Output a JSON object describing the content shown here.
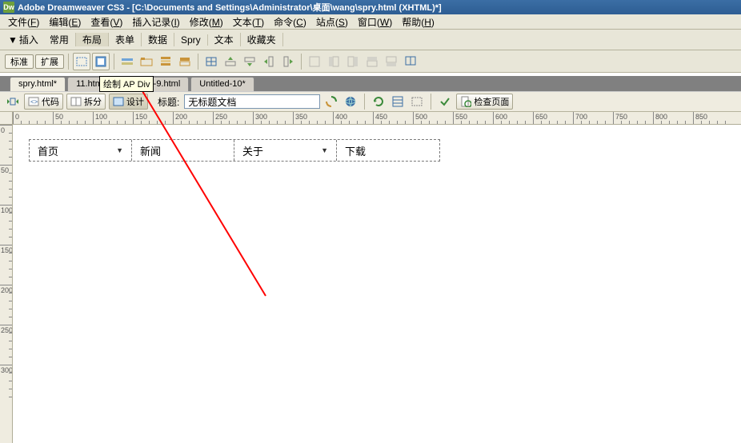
{
  "title": "Adobe Dreamweaver CS3 - [C:\\Documents and Settings\\Administrator\\桌面\\wang\\spry.html (XHTML)*]",
  "dw_badge": "Dw",
  "menu": [
    {
      "l": "文件",
      "k": "F"
    },
    {
      "l": "编辑",
      "k": "E"
    },
    {
      "l": "查看",
      "k": "V"
    },
    {
      "l": "插入记录",
      "k": "I"
    },
    {
      "l": "修改",
      "k": "M"
    },
    {
      "l": "文本",
      "k": "T"
    },
    {
      "l": "命令",
      "k": "C"
    },
    {
      "l": "站点",
      "k": "S"
    },
    {
      "l": "窗口",
      "k": "W"
    },
    {
      "l": "帮助",
      "k": "H"
    }
  ],
  "insert_label": "插入",
  "insert_tabs": [
    "常用",
    "布局",
    "表单",
    "数据",
    "Spry",
    "文本",
    "收藏夹"
  ],
  "pills": {
    "std": "标准",
    "expand": "扩展"
  },
  "tooltip": "绘制 AP Div",
  "doc_tabs": [
    {
      "label": "spry.html*",
      "active": true
    },
    {
      "label": "11.html",
      "active": false
    },
    {
      "label": "Untitled-9.html",
      "active": false
    },
    {
      "label": "Untitled-10*",
      "active": false
    }
  ],
  "view_buttons": {
    "code": "代码",
    "split": "拆分",
    "design": "设计"
  },
  "title_label": "标题:",
  "doc_title": "无标题文档",
  "check_page": "检查页面",
  "spry_items": [
    {
      "label": "首页",
      "arrow": true
    },
    {
      "label": "新闻",
      "arrow": false
    },
    {
      "label": "关于",
      "arrow": true
    },
    {
      "label": "下载",
      "arrow": false
    }
  ],
  "ruler_marks_h": [
    0,
    50,
    100,
    150,
    200,
    250,
    300,
    350,
    400,
    450,
    500,
    550,
    600,
    650,
    700,
    750,
    800,
    850
  ],
  "ruler_marks_v": [
    0,
    50,
    100,
    150,
    200,
    250,
    300
  ],
  "colors": {
    "accent": "#3b6ea5",
    "panel": "#e8e6d8"
  }
}
